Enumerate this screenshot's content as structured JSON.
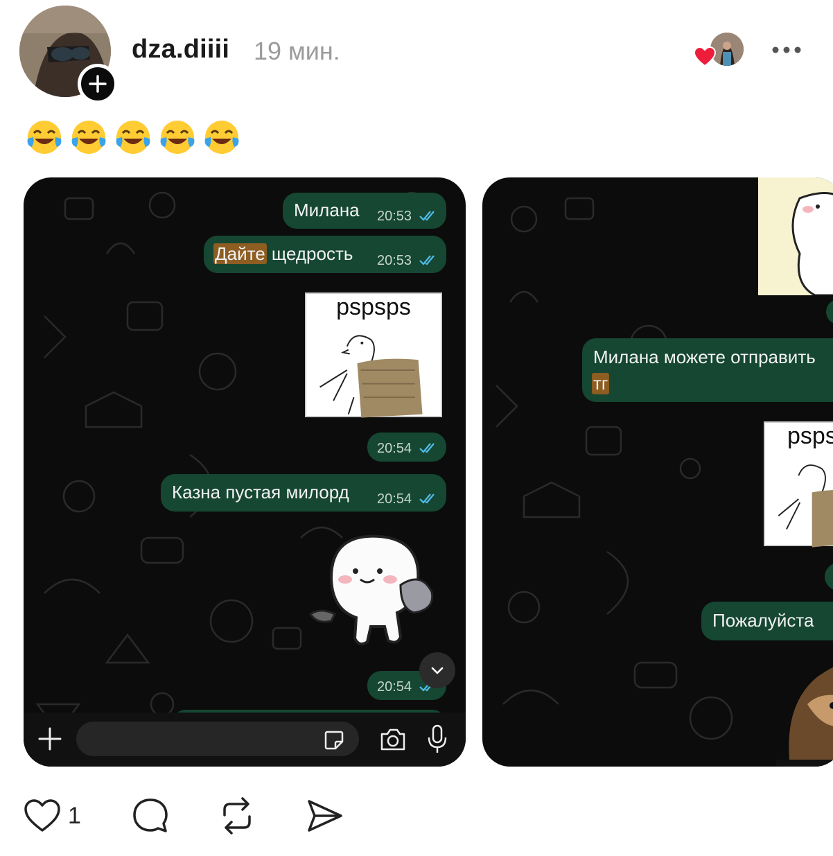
{
  "post": {
    "username": "dza.diiii",
    "time_ago": "19 мин.",
    "caption_emojis": [
      "face-with-tears-of-joy",
      "face-with-tears-of-joy",
      "face-with-tears-of-joy",
      "face-with-tears-of-joy",
      "face-with-tears-of-joy"
    ],
    "like_count": "1",
    "icons": {
      "follow": "plus-icon",
      "more": "more-horizontal-icon",
      "like": "heart-icon",
      "comment": "comment-icon",
      "repost": "repost-icon",
      "share": "share-icon"
    }
  },
  "chat1": {
    "messages": [
      {
        "text": "Милана",
        "time": "20:53"
      },
      {
        "highlight": "Дайте",
        "text": " щедрость",
        "time": "20:53"
      },
      {
        "sticker_caption": "pspsps"
      },
      {
        "text": "",
        "time": "20:54"
      },
      {
        "text": "Казна пустая милорд",
        "time": "20:54"
      },
      {
        "text": "",
        "time": "20:54"
      }
    ]
  },
  "chat2": {
    "messages": [
      {
        "text": "Милана можете отправить",
        "highlight": "тг"
      },
      {
        "sticker_caption": "psps"
      },
      {
        "text": "Пожалуйста"
      }
    ]
  },
  "colors": {
    "bubble": "#154733",
    "chat_bg": "#0c0c0c",
    "highlight": "#8d5d22",
    "read_ticks": "#53bdeb",
    "heart_red": "#ee1d3b"
  }
}
